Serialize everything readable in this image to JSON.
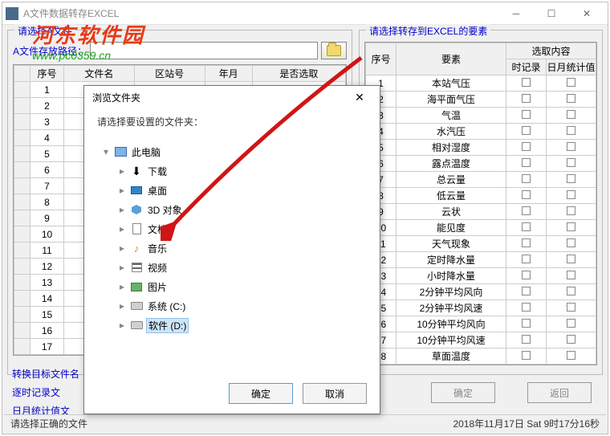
{
  "watermark": {
    "cn": "河东软件园",
    "url": "www.pc0359.cn"
  },
  "window": {
    "title": "A文件数据转存EXCEL"
  },
  "left_panel": {
    "group_label": "请选择A文件",
    "path_label": "A文件存放路径：",
    "columns": [
      "序号",
      "文件名",
      "区站号",
      "年月",
      "是否选取"
    ],
    "row_numbers": [
      1,
      2,
      3,
      4,
      5,
      6,
      7,
      8,
      9,
      10,
      11,
      12,
      13,
      14,
      15,
      16,
      17
    ]
  },
  "right_panel": {
    "group_label": "请选择转存到EXCEL的要素",
    "col_num": "序号",
    "col_elem": "要素",
    "col_sel": "选取内容",
    "col_hr": "时记录",
    "col_stat": "日月统计值",
    "items": [
      "本站气压",
      "海平面气压",
      "气温",
      "水汽压",
      "相对湿度",
      "露点温度",
      "总云量",
      "低云量",
      "云状",
      "能见度",
      "天气现象",
      "定时降水量",
      "小时降水量",
      "2分钟平均风向",
      "2分钟平均风速",
      "10分钟平均风向",
      "10分钟平均风速",
      "草面温度"
    ]
  },
  "side_links": {
    "a": "转换目标文件名",
    "b": "逐时记录文",
    "c": "日月统计值文"
  },
  "buttons": {
    "ok": "确定",
    "back": "返回"
  },
  "status": {
    "left": "请选择正确的文件",
    "right": "2018年11月17日  Sat 9时17分16秒"
  },
  "dialog": {
    "title": "浏览文件夹",
    "msg": "请选择要设置的文件夹：",
    "ok": "确定",
    "cancel": "取消",
    "tree": [
      {
        "indent": 0,
        "icon": "pc",
        "label": "此电脑",
        "expand": "▾"
      },
      {
        "indent": 1,
        "icon": "dl",
        "label": "下载",
        "expand": "▸"
      },
      {
        "indent": 1,
        "icon": "desk",
        "label": "桌面",
        "expand": "▸"
      },
      {
        "indent": 1,
        "icon": "3d",
        "label": "3D 对象",
        "expand": "▸"
      },
      {
        "indent": 1,
        "icon": "doc",
        "label": "文档",
        "expand": "▸"
      },
      {
        "indent": 1,
        "icon": "music",
        "label": "音乐",
        "expand": "▸"
      },
      {
        "indent": 1,
        "icon": "video",
        "label": "视频",
        "expand": "▸"
      },
      {
        "indent": 1,
        "icon": "pic",
        "label": "图片",
        "expand": "▸"
      },
      {
        "indent": 1,
        "icon": "drive",
        "label": "系统 (C:)",
        "expand": "▸"
      },
      {
        "indent": 1,
        "icon": "drive",
        "label": "软件 (D:)",
        "expand": "▸",
        "selected": true
      }
    ]
  }
}
